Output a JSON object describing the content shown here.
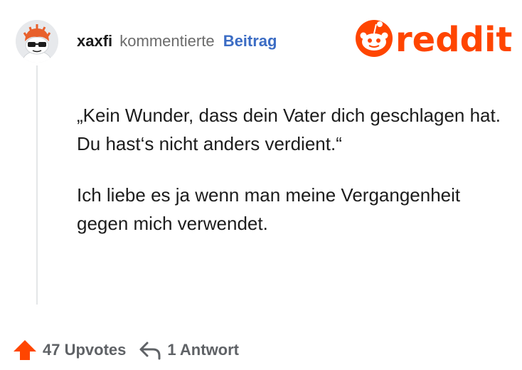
{
  "comment": {
    "username": "xaxfi",
    "action_text": "kommentierte",
    "post_link_label": "Beitrag",
    "paragraphs": [
      "„Kein Wunder, dass dein Vater dich geschlagen hat. Du hast‘s nicht anders verdient.“",
      "Ich liebe es ja wenn man meine Vergangenheit gegen mich verwendet."
    ]
  },
  "brand": {
    "wordmark": "reddit",
    "icon": "reddit-snoo-icon",
    "color": "#ff4500"
  },
  "footer": {
    "upvotes_label": "47 Upvotes",
    "upvote_icon": "upvote-arrow-icon",
    "upvote_color": "#ff4500",
    "replies_label": "1 Antwort",
    "reply_icon": "reply-arrow-icon"
  }
}
